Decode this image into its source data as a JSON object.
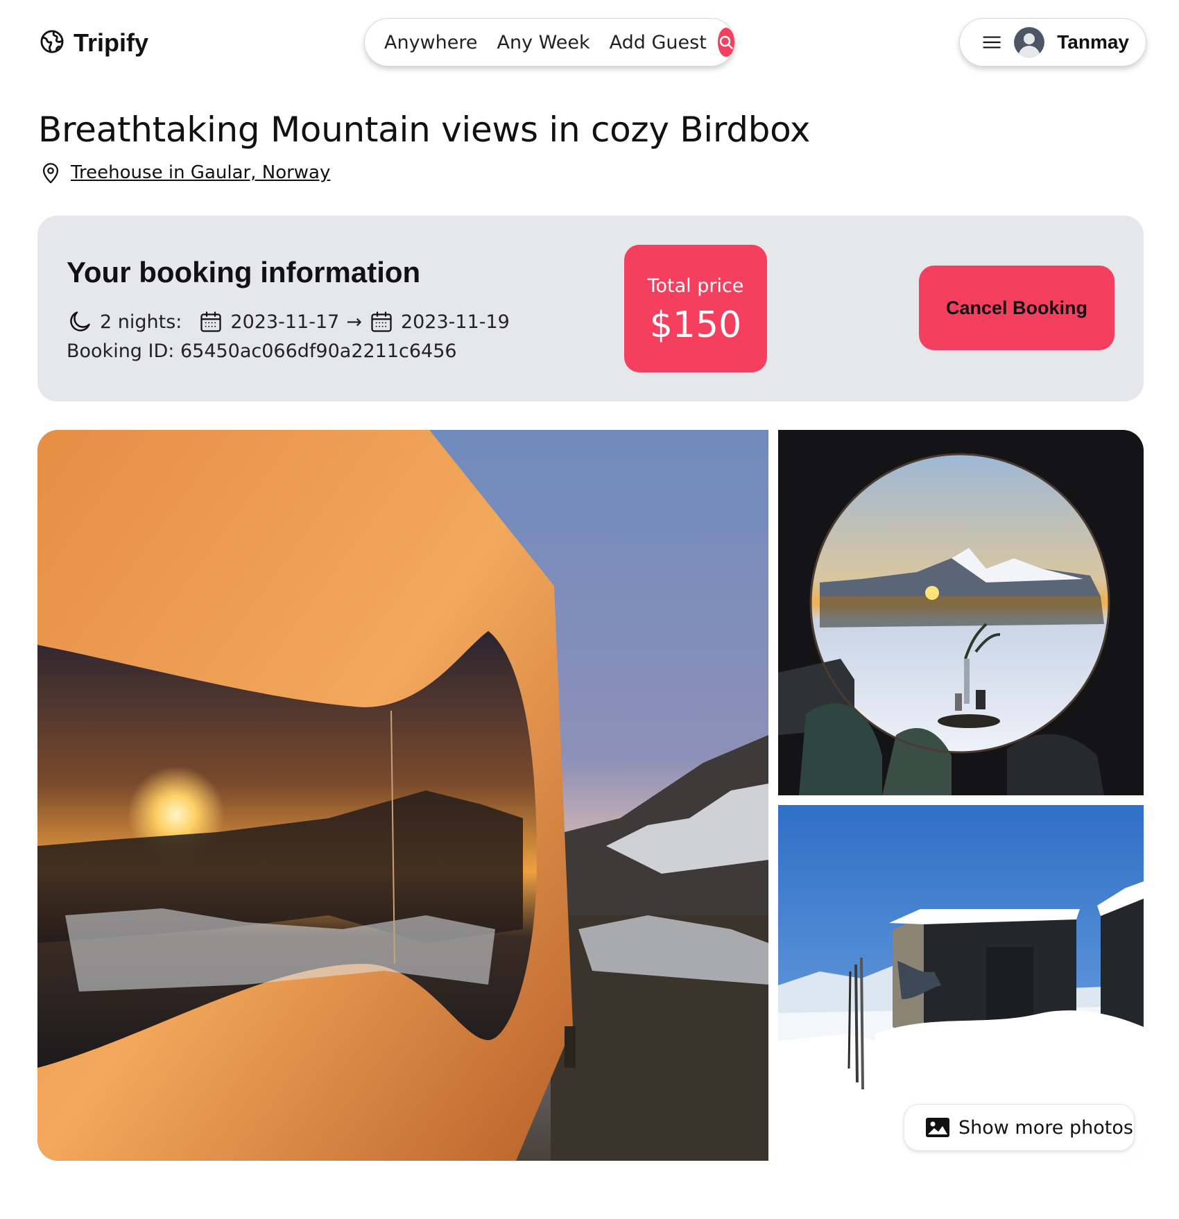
{
  "brand": {
    "name": "Tripify",
    "accent": "#f43f5e"
  },
  "search": {
    "where": "Anywhere",
    "when": "Any Week",
    "guests": "Add Guest"
  },
  "user": {
    "name": "Tanmay"
  },
  "listing": {
    "title": "Breathtaking Mountain views in cozy Birdbox",
    "location": "Treehouse in Gaular, Norway"
  },
  "booking": {
    "heading": "Your booking information",
    "nights": "2 nights:",
    "check_in": "2023-11-17",
    "arrow": "→",
    "check_out": "2023-11-19",
    "booking_id": "Booking ID: 65450ac066df90a2211c6456",
    "price_label": "Total price",
    "price_value": "$150",
    "cancel_label": "Cancel Booking"
  },
  "gallery": {
    "show_more_label": "Show more photos"
  }
}
